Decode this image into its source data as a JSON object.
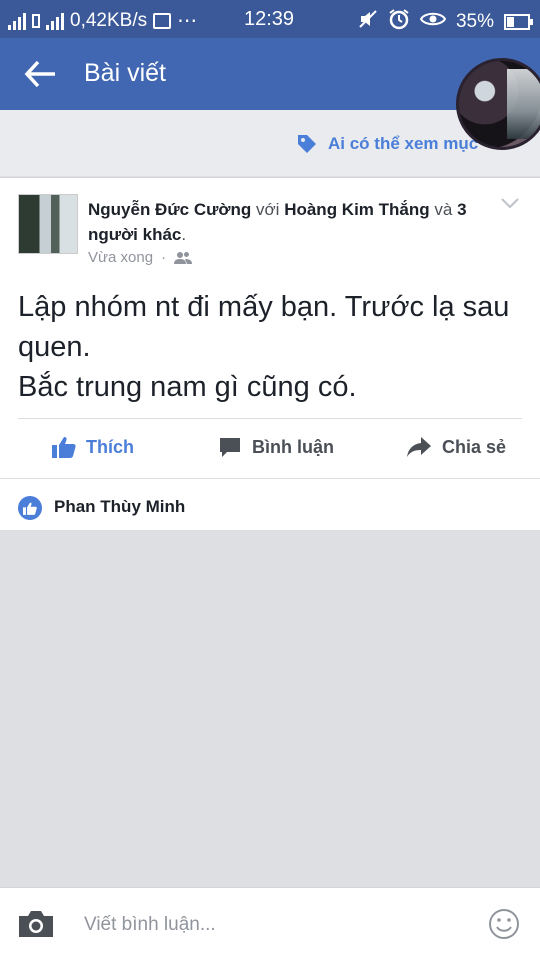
{
  "status_bar": {
    "speed": "0,42KB/s",
    "time": "12:39",
    "battery": "35%",
    "icons": [
      "signal-icon",
      "data-icon",
      "media-icon",
      "more-dots-icon",
      "mute-icon",
      "alarm-icon",
      "eye-icon",
      "battery-icon"
    ]
  },
  "app_bar": {
    "title": "Bài viết",
    "back_icon": "arrow-left-icon"
  },
  "privacy": {
    "label": "Ai có thể xem mục",
    "icon": "tag-icon"
  },
  "post": {
    "author": "Nguyễn Đức Cường",
    "with_word": "với",
    "tagged": "Hoàng Kim Thắng",
    "and_word": "và",
    "others": "3 người khác",
    "time": "Vừa xong",
    "audience_icon": "friends-icon",
    "text": "Lập nhóm nt đi mấy bạn. Trước lạ sau quen.\nBắc trung nam gì cũng có."
  },
  "actions": {
    "like": "Thích",
    "comment": "Bình luận",
    "share": "Chia sẻ"
  },
  "likes": {
    "name": "Phan Thùy Minh"
  },
  "composer": {
    "placeholder": "Viết bình luận..."
  },
  "colors": {
    "statusbar": "#3b5998",
    "appbar": "#4267b2",
    "accent": "#4a7ed8"
  }
}
